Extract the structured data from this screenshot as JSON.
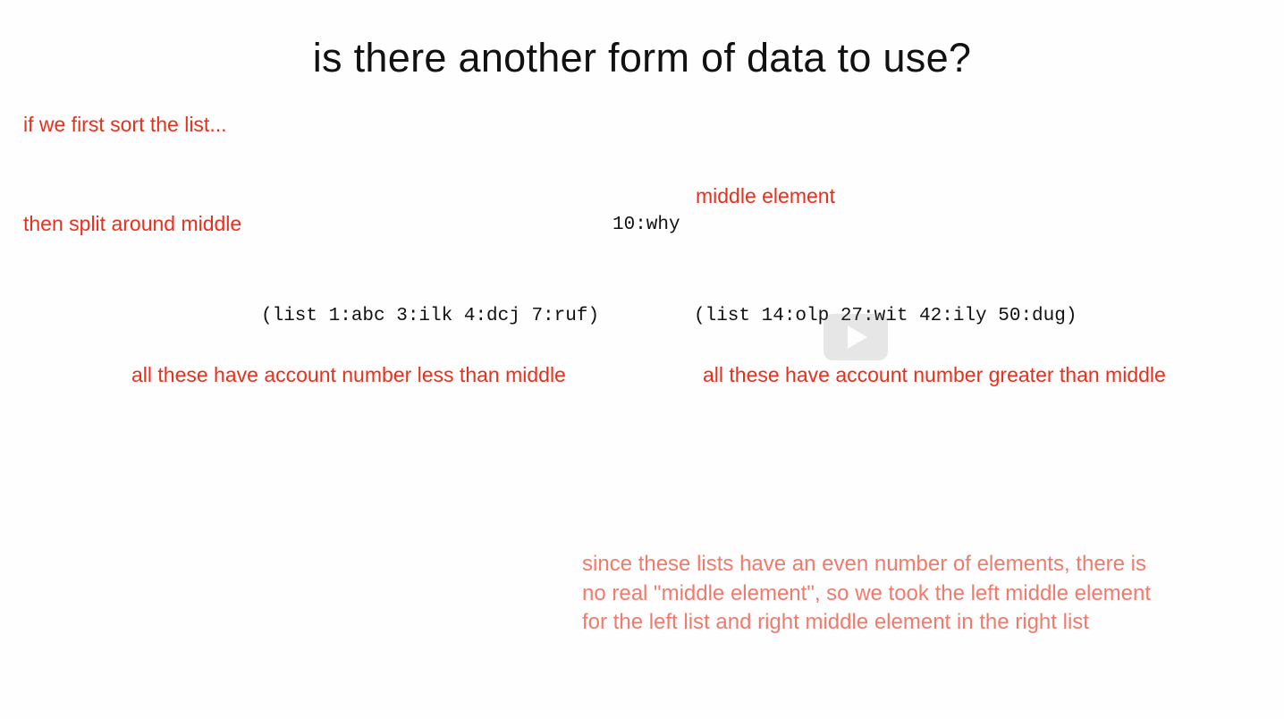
{
  "slide": {
    "title": "is there another form of data to use?",
    "step1": "if we first sort the list...",
    "step2": "then split around middle",
    "middle_label": "middle element",
    "middle_value": "10:why",
    "left_list": "(list 1:abc 3:ilk 4:dcj 7:ruf)",
    "right_list": "(list 14:olp 27:wit 42:ily 50:dug)",
    "left_caption": "all these have account number less than middle",
    "right_caption": "all these have account number greater than middle",
    "note_lines": [
      "since these lists have an even number of elements, there is",
      "no real \"middle element\", so we took the left middle element",
      "for the left list and right middle element in the right list"
    ]
  },
  "colors": {
    "accent_red": "#e8301c",
    "note_salmon": "#f27a6c",
    "text_black": "#111111"
  },
  "player": {
    "icon": "play-icon"
  }
}
